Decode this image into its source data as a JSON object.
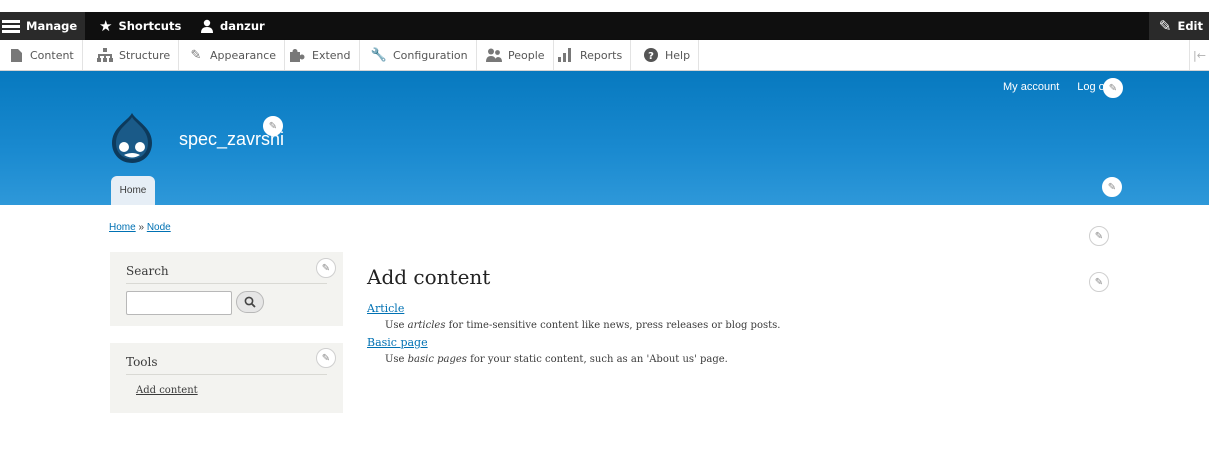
{
  "toolbar": {
    "manage": "Manage",
    "shortcuts": "Shortcuts",
    "user": "danzur",
    "edit": "Edit"
  },
  "tray": {
    "items": [
      {
        "label": "Content",
        "icon": "file-icon"
      },
      {
        "label": "Structure",
        "icon": "sitemap-icon"
      },
      {
        "label": "Appearance",
        "icon": "paintbrush-icon"
      },
      {
        "label": "Extend",
        "icon": "puzzle-icon"
      },
      {
        "label": "Configuration",
        "icon": "wrench-icon"
      },
      {
        "label": "People",
        "icon": "people-icon"
      },
      {
        "label": "Reports",
        "icon": "bar-chart-icon"
      },
      {
        "label": "Help",
        "icon": "help-icon"
      }
    ]
  },
  "header": {
    "my_account": "My account",
    "log_out": "Log o",
    "site_name": "spec_zavrsni",
    "tab_home": "Home"
  },
  "breadcrumb": {
    "home": "Home",
    "separator": "»",
    "node": "Node"
  },
  "sidebar": {
    "search_title": "Search",
    "tools_title": "Tools",
    "tools_link": "Add content"
  },
  "main": {
    "title": "Add content",
    "types": [
      {
        "name": "Article",
        "desc_prefix": "Use ",
        "desc_em": "articles",
        "desc_suffix": " for time-sensitive content like news, press releases or blog posts."
      },
      {
        "name": "Basic page",
        "desc_prefix": "Use ",
        "desc_em": "basic pages",
        "desc_suffix": " for your static content, such as an 'About us' page."
      }
    ]
  },
  "colors": {
    "header_blue": "#0779bf",
    "link_blue": "#0071b3",
    "toolbar_black": "#0f0f0f"
  }
}
